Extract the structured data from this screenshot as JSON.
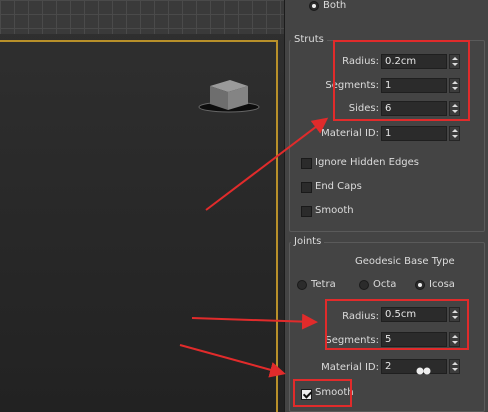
{
  "top_option": {
    "label": "Both",
    "selected": true
  },
  "struts": {
    "title": "Struts",
    "radius": {
      "label": "Radius:",
      "value": "0.2cm"
    },
    "segments": {
      "label": "Segments:",
      "value": "1"
    },
    "sides": {
      "label": "Sides:",
      "value": "6"
    },
    "material_id": {
      "label": "Material ID:",
      "value": "1"
    },
    "ignore_hidden_edges": {
      "label": "Ignore Hidden Edges",
      "checked": false
    },
    "end_caps": {
      "label": "End Caps",
      "checked": false
    },
    "smooth": {
      "label": "Smooth",
      "checked": false
    }
  },
  "joints": {
    "title": "Joints",
    "base_type_label": "Geodesic Base Type",
    "options": [
      {
        "label": "Tetra",
        "selected": false
      },
      {
        "label": "Octa",
        "selected": false
      },
      {
        "label": "Icosa",
        "selected": true
      }
    ],
    "radius": {
      "label": "Radius:",
      "value": "0.5cm"
    },
    "segments": {
      "label": "Segments:",
      "value": "5"
    },
    "material_id": {
      "label": "Material ID:",
      "value": "2"
    },
    "smooth": {
      "label": "Smooth",
      "checked": true
    }
  },
  "colors": {
    "highlight": "#e12b2b",
    "viewport_border": "#b8902a",
    "panel_bg": "#444444"
  }
}
